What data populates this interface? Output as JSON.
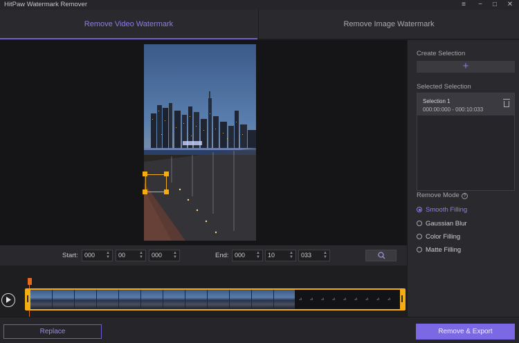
{
  "app": {
    "title": "HitPaw Watermark Remover"
  },
  "window_controls": {
    "menu": "≡",
    "minimize": "−",
    "maximize": "□",
    "close": "✕"
  },
  "tabs": [
    {
      "label": "Remove Video Watermark",
      "active": true
    },
    {
      "label": "Remove Image Watermark",
      "active": false
    }
  ],
  "controls": {
    "start_label": "Start:",
    "start": [
      "000",
      "00",
      "000"
    ],
    "end_label": "End:",
    "end": [
      "000",
      "10",
      "033"
    ],
    "zoom_icon": "search-icon"
  },
  "buttons": {
    "replace": "Replace",
    "export": "Remove & Export"
  },
  "panel": {
    "create_selection": "Create Selection",
    "create_button": "+",
    "selected_selection": "Selected Selection",
    "selections": [
      {
        "name": "Selection 1",
        "range": "000:00:000 - 000:10:033"
      }
    ],
    "remove_mode": "Remove Mode",
    "help": "?",
    "modes": [
      {
        "label": "Smooth Filling",
        "selected": true
      },
      {
        "label": "Gaussian Blur",
        "selected": false
      },
      {
        "label": "Color Filling",
        "selected": false
      },
      {
        "label": "Matte Filling",
        "selected": false
      }
    ]
  },
  "colors": {
    "accent": "#7a68e4",
    "selection_handle": "#f5ad14",
    "playhead": "#e46a1c"
  }
}
